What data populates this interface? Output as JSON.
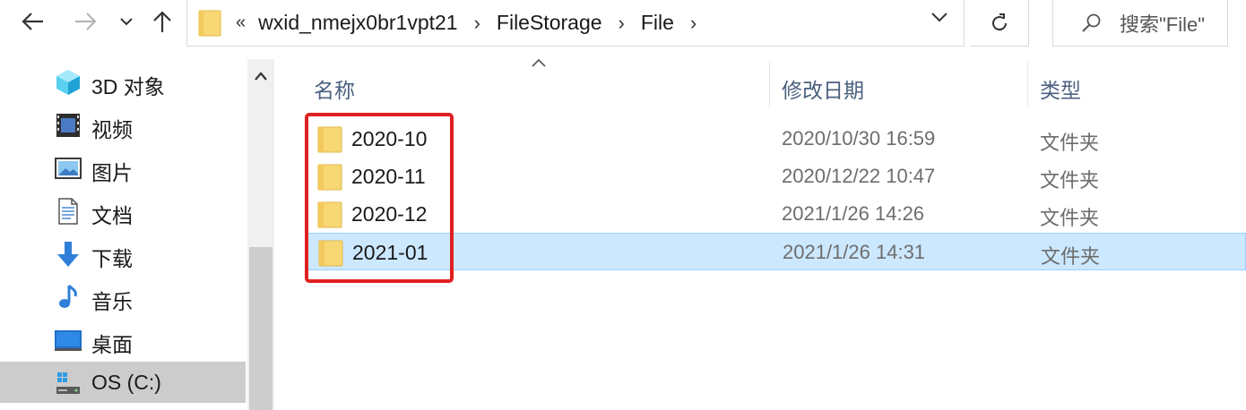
{
  "toolbar": {
    "back_icon": "arrow-left-icon",
    "forward_icon": "arrow-right-icon",
    "recent_icon": "chevron-down-icon",
    "up_icon": "arrow-up-icon",
    "refresh_icon": "refresh-icon"
  },
  "address": {
    "overflow": "«",
    "crumbs": [
      "wxid_nmejx0br1vpt21",
      "FileStorage",
      "File"
    ],
    "separator": "›"
  },
  "search": {
    "placeholder": "搜索\"File\""
  },
  "sidebar": {
    "items": [
      {
        "label": "3D 对象",
        "icon": "3d-objects-icon"
      },
      {
        "label": "视频",
        "icon": "video-icon"
      },
      {
        "label": "图片",
        "icon": "pictures-icon"
      },
      {
        "label": "文档",
        "icon": "documents-icon"
      },
      {
        "label": "下载",
        "icon": "download-icon"
      },
      {
        "label": "音乐",
        "icon": "music-icon"
      },
      {
        "label": "桌面",
        "icon": "desktop-icon"
      },
      {
        "label": "OS (C:)",
        "icon": "drive-icon",
        "active": true
      }
    ]
  },
  "columns": {
    "name": "名称",
    "modified": "修改日期",
    "type": "类型"
  },
  "files": [
    {
      "name": "2020-10",
      "modified": "2020/10/30 16:59",
      "type": "文件夹"
    },
    {
      "name": "2020-11",
      "modified": "2020/12/22 10:47",
      "type": "文件夹"
    },
    {
      "name": "2020-12",
      "modified": "2021/1/26 14:26",
      "type": "文件夹"
    },
    {
      "name": "2021-01",
      "modified": "2021/1/26 14:31",
      "type": "文件夹",
      "selected": true
    }
  ],
  "colors": {
    "selection_bg": "#cce8ff",
    "selection_border": "#99d1ff",
    "highlight_box": "#e02020",
    "folder_yellow": "#f8d775"
  }
}
